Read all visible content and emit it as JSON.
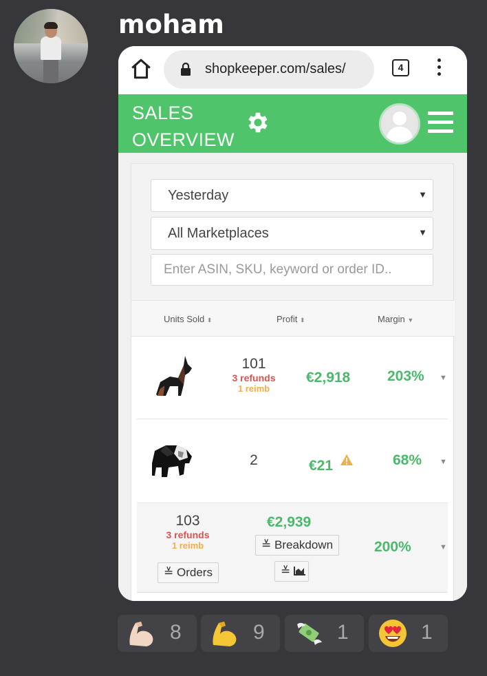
{
  "message": {
    "username": "moham"
  },
  "browser": {
    "url": "shopkeeper.com/sales/",
    "tab_count": "4"
  },
  "app": {
    "title": "SALES OVERVIEW"
  },
  "filters": {
    "period": "Yesterday",
    "marketplace": "All Marketplaces",
    "search_placeholder": "Enter ASIN, SKU, keyword or order ID.."
  },
  "table": {
    "columns": {
      "units": "Units Sold",
      "profit": "Profit",
      "margin": "Margin"
    },
    "rows": [
      {
        "product_icon": "doberman-origami",
        "units": "101",
        "refunds": "3 refunds",
        "reimb": "1 reimb",
        "profit": "€2,918",
        "margin": "203%",
        "warning": false
      },
      {
        "product_icon": "bear-origami",
        "units": "2",
        "profit": "€21",
        "margin": "68%",
        "warning": true
      }
    ],
    "total": {
      "units": "103",
      "refunds": "3 refunds",
      "reimb": "1 reimb",
      "profit": "€2,939",
      "margin": "200%",
      "orders_label": "Orders",
      "breakdown_label": "Breakdown"
    }
  },
  "reactions": [
    {
      "emoji": "flexed-biceps-light",
      "count": "8"
    },
    {
      "emoji": "flexed-biceps",
      "count": "9"
    },
    {
      "emoji": "money-with-wings",
      "count": "1"
    },
    {
      "emoji": "heart-eyes",
      "count": "1"
    }
  ],
  "colors": {
    "app_green": "#4fc46b",
    "profit_green": "#4bb86b",
    "refund_red": "#d9534f",
    "reimb_orange": "#f0ad4e",
    "background": "#36363b"
  }
}
